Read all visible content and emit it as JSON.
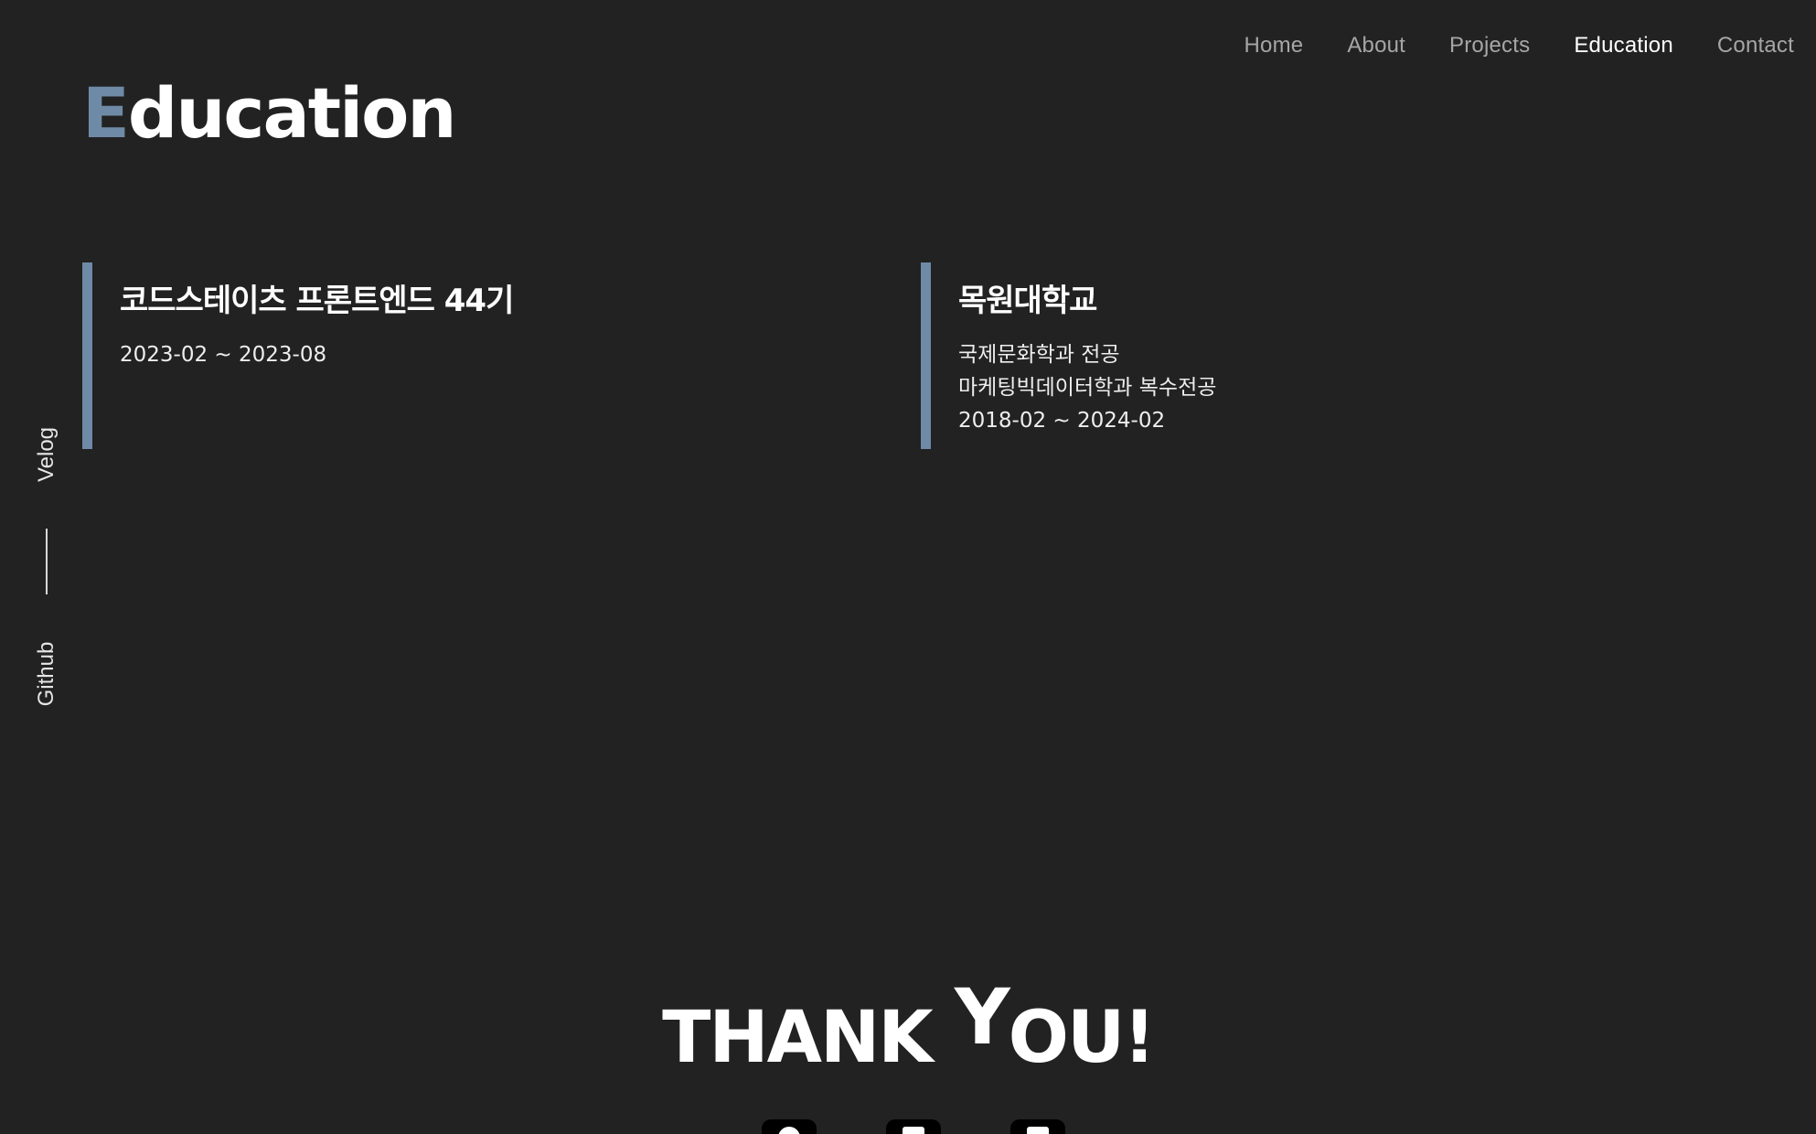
{
  "nav": {
    "items": [
      {
        "label": "Home",
        "active": false
      },
      {
        "label": "About",
        "active": false
      },
      {
        "label": "Projects",
        "active": false
      },
      {
        "label": "Education",
        "active": true
      },
      {
        "label": "Contact",
        "active": false
      }
    ]
  },
  "page": {
    "title_first": "E",
    "title_rest": "ducation"
  },
  "side": {
    "velog": "Velog",
    "github": "Github"
  },
  "education": [
    {
      "name": "코드스테이츠 프론트엔드 44기",
      "lines": [
        "2023-02 ~ 2023-08"
      ]
    },
    {
      "name": "목원대학교",
      "lines": [
        "국제문화학과 전공",
        "마케팅빅데이터학과 복수전공",
        "2018-02 ~ 2024-02"
      ]
    }
  ],
  "thanks": {
    "part1": "THANK ",
    "y": "Y",
    "part2": "OU!"
  },
  "footer_icons": [
    "github-icon",
    "velog-icon",
    "mail-icon"
  ],
  "colors": {
    "background": "#222222",
    "accent": "#6f8aa6",
    "nav_inactive": "#a6a6a6",
    "text": "#ffffff"
  }
}
